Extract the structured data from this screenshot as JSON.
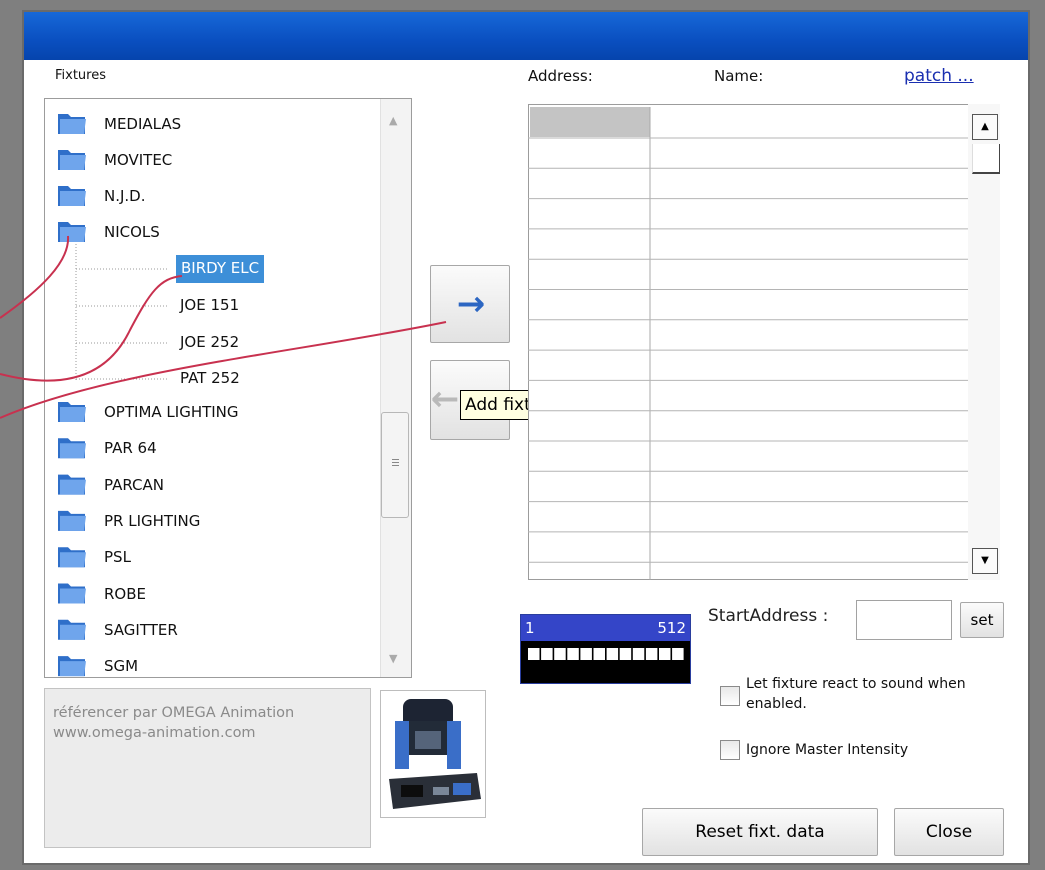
{
  "window": {
    "fixtures_label": "Fixtures",
    "address_header": "Address:",
    "name_header": "Name:",
    "patch_link": "patch ..."
  },
  "tree": {
    "folders_top": [
      "MEDIALAS",
      "MOVITEC",
      "N.J.D.",
      "NICOLS"
    ],
    "children": [
      "BIRDY ELC",
      "JOE 151",
      "JOE 252",
      "PAT 252"
    ],
    "selected_child": "BIRDY ELC",
    "folders_bottom": [
      "OPTIMA LIGHTING",
      "PAR 64",
      "PARCAN",
      "PR LIGHTING",
      "PSL",
      "ROBE",
      "SAGITTER",
      "SGM"
    ]
  },
  "description": {
    "line1": "référencer par OMEGA Animation",
    "line2": "www.omega-animation.com"
  },
  "buttons": {
    "add_arrow": "→",
    "remove_arrow": "←",
    "tooltip": "Add fixture",
    "set": "set",
    "reset": "Reset fixt. data",
    "close": "Close"
  },
  "dmx": {
    "start": "1",
    "end": "512"
  },
  "start_address": {
    "label": "StartAddress :",
    "value": ""
  },
  "options": {
    "sound_label": "Let fixture react to sound when enabled.",
    "sound_checked": false,
    "ignore_master_label": "Ignore Master Intensity",
    "ignore_master_checked": false
  },
  "colors": {
    "titlebar": "#0a4fc0",
    "selection": "#3d8fd8",
    "dmx_bar": "#3445c8",
    "annotation_line": "#c8314f"
  },
  "icons": {
    "folder": "folder-icon",
    "fixture_image": "moving-head-image"
  }
}
